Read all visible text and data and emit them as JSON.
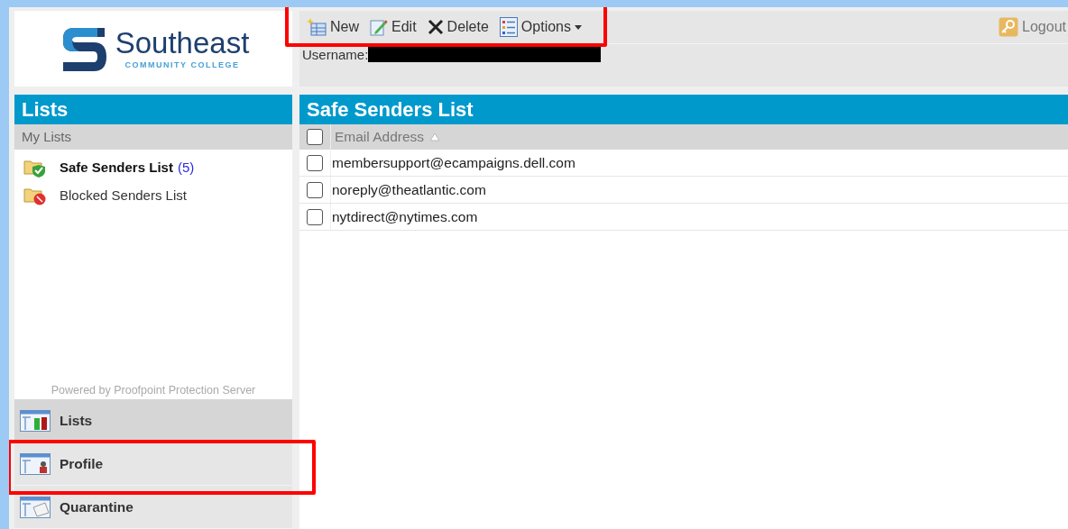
{
  "logo": {
    "name": "Southeast",
    "subtitle": "COMMUNITY COLLEGE"
  },
  "toolbar": {
    "highlighted": true,
    "buttons": [
      {
        "label": "New",
        "kind": "new"
      },
      {
        "label": "Edit",
        "kind": "edit"
      },
      {
        "label": "Delete",
        "kind": "delete"
      },
      {
        "label": "Options",
        "kind": "options"
      }
    ],
    "logout": "Logout"
  },
  "user": {
    "label": "Username:",
    "redacted": true
  },
  "sidebar": {
    "title": "Lists",
    "section": "My Lists",
    "items": [
      {
        "label": "Safe Senders List",
        "count": "(5)",
        "selected": true,
        "kind": "safe"
      },
      {
        "label": "Blocked Senders List",
        "selected": false,
        "kind": "blocked"
      }
    ],
    "footer": "Powered by Proofpoint Protection Server",
    "nav": [
      {
        "label": "Lists",
        "selected": true,
        "highlighted": false,
        "kind": "lists"
      },
      {
        "label": "Profile",
        "selected": false,
        "highlighted": true,
        "kind": "profile"
      },
      {
        "label": "Quarantine",
        "selected": false,
        "highlighted": false,
        "kind": "quarantine"
      }
    ]
  },
  "main": {
    "title": "Safe Senders List",
    "table": {
      "select_all": {
        "checked": false
      },
      "column": "Email Address",
      "sorted_ascending": true,
      "rows": [
        {
          "email": "membersupport@ecampaigns.dell.com",
          "checked": false
        },
        {
          "email": "noreply@theatlantic.com",
          "checked": false
        },
        {
          "email": "nytdirect@nytimes.com",
          "checked": false
        }
      ]
    }
  }
}
